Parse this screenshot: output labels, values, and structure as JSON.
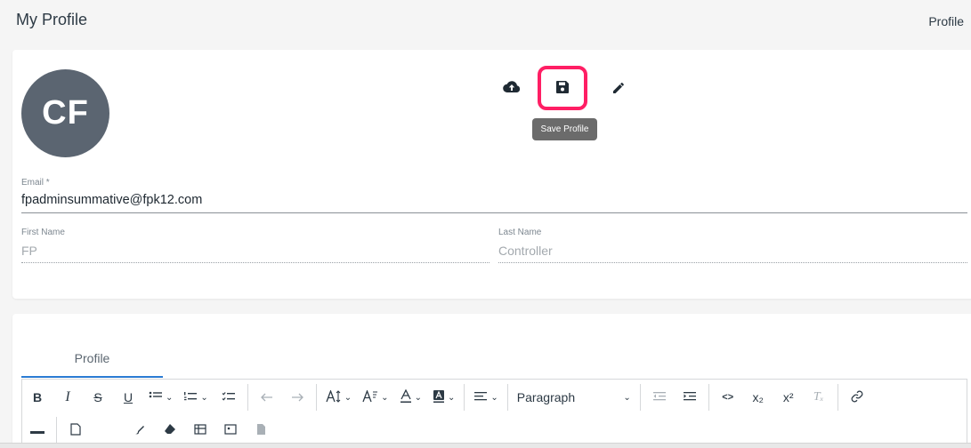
{
  "header": {
    "title": "My Profile",
    "breadcrumb": "Profile"
  },
  "avatar": {
    "initials": "CF"
  },
  "actions": {
    "upload_icon": "cloud-upload-icon",
    "save_icon": "floppy-disk-icon",
    "edit_icon": "pencil-icon",
    "save_tooltip": "Save Profile",
    "highlight_color": "#ff1e64"
  },
  "form": {
    "email": {
      "label": "Email *",
      "value": "fpadminsummative@fpk12.com"
    },
    "first_name": {
      "label": "First Name",
      "value": "FP"
    },
    "last_name": {
      "label": "Last Name",
      "value": "Controller"
    }
  },
  "tabs": [
    {
      "label": "Profile",
      "active": true
    }
  ],
  "editor": {
    "bold": "B",
    "italic": "I",
    "strike": "S",
    "underline": "U",
    "block_format": "Paragraph",
    "code": "<>",
    "subscript": "x₂",
    "superscript": "x²",
    "clear_format": "Tₓ"
  }
}
